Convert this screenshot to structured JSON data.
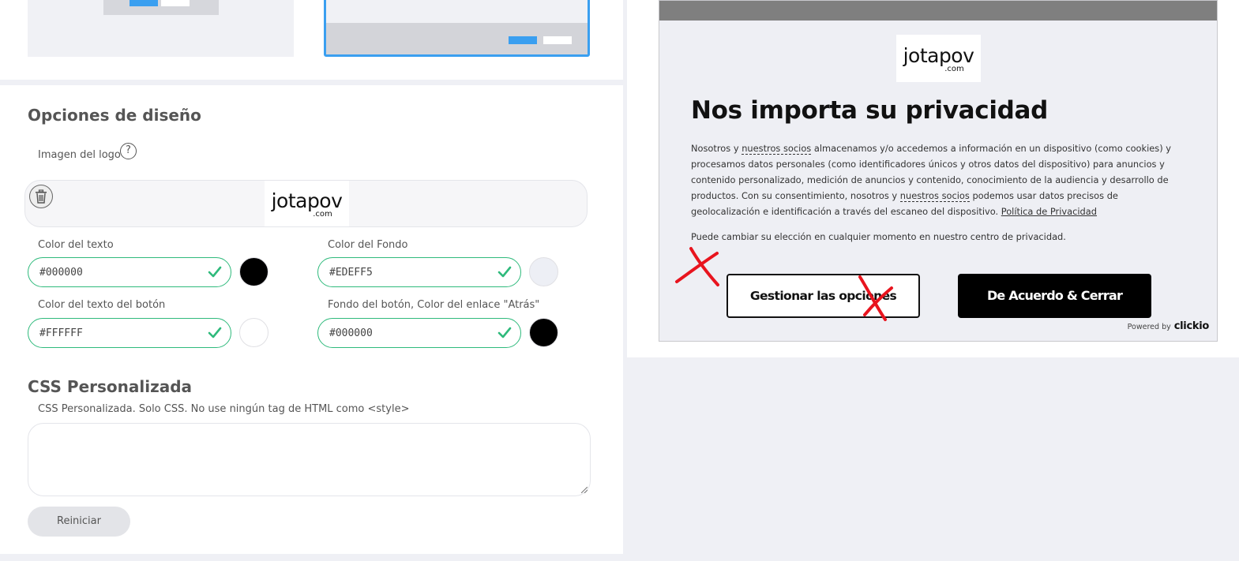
{
  "design_section": {
    "title": "Opciones de diseño",
    "logo_label": "Imagen del logo",
    "help_icon": "?"
  },
  "logo": {
    "text": "jotapov",
    "sub": ".com"
  },
  "colors": {
    "text_color": {
      "label": "Color del texto",
      "value": "#000000",
      "swatch": "#000000"
    },
    "bg_color": {
      "label": "Color del Fondo",
      "value": "#EDEFF5",
      "swatch": "#EDEFF5"
    },
    "button_text_color": {
      "label": "Color del texto del botón",
      "value": "#FFFFFF",
      "swatch": "#FFFFFF"
    },
    "button_bg_color": {
      "label": "Fondo del botón, Color del enlace \"Atrás\"",
      "value": "#000000",
      "swatch": "#000000"
    }
  },
  "css_section": {
    "title": "CSS Personalizada",
    "label": "CSS Personalizada. Solo CSS. No use ningún tag de HTML como <style>",
    "value": "",
    "reset_label": "Reiniciar"
  },
  "preview": {
    "title": "Nos importa su privacidad",
    "p1_a": "Nosotros y ",
    "p1_partners_1": "nuestros socios",
    "p1_b": " almacenamos y/o accedemos a información en un dispositivo (como cookies) y procesamos datos personales (como identificadores únicos y otros datos del dispositivo) para anuncios y contenido personalizado, medición de anuncios y contenido, conocimiento de la audiencia y desarrollo de productos. Con su consentimiento, nosotros y ",
    "p1_partners_2": "nuestros socios",
    "p1_c": " podemos usar datos precisos de geolocalización e identificación a través del escaneo del dispositivo. ",
    "p1_policy": "Política de Privacidad",
    "p2": "Puede cambiar su elección en cualquier momento en nuestro centro de privacidad.",
    "manage_label": "Gestionar las opciones",
    "agree_label": "De Acuerdo & Cerrar",
    "powered_by": "Powered by",
    "brand": "clickio"
  },
  "accent_colors": {
    "valid": "#2fba7c",
    "selection": "#3a9ff0",
    "annotation": "#e8141e"
  }
}
